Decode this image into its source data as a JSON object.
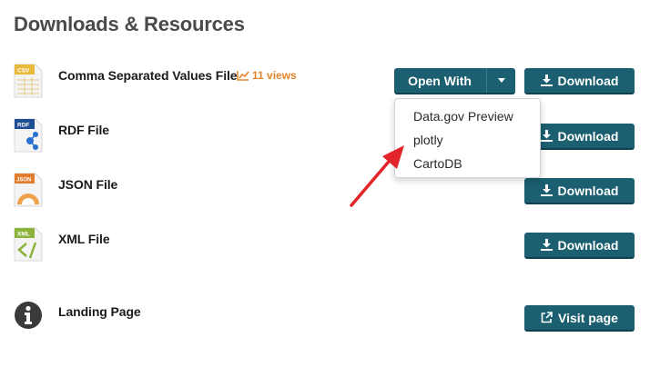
{
  "page": {
    "title": "Downloads & Resources"
  },
  "resources": [
    {
      "name": "Comma Separated Values File",
      "icon": "csv-file-icon",
      "icon_label": "CSV",
      "views": "11 views"
    },
    {
      "name": "RDF File",
      "icon": "rdf-file-icon",
      "icon_label": "RDF"
    },
    {
      "name": "JSON File",
      "icon": "json-file-icon",
      "icon_label": "JSON"
    },
    {
      "name": "XML File",
      "icon": "xml-file-icon",
      "icon_label": "XML"
    },
    {
      "name": "Landing Page",
      "icon": "info-icon"
    }
  ],
  "buttons": {
    "open_with": "Open With",
    "download": "Download",
    "visit_page": "Visit page"
  },
  "open_with_menu": [
    "Data.gov Preview",
    "plotly",
    "CartoDB"
  ],
  "colors": {
    "button_bg": "#1b5f70",
    "views_orange": "#e5832b",
    "arrow_red": "#e3242b"
  }
}
